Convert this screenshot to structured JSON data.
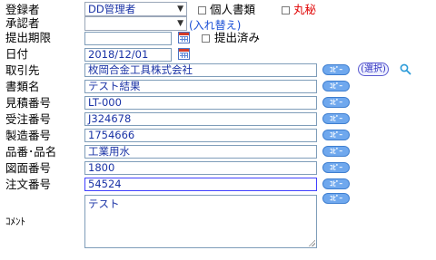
{
  "labels": {
    "registrant": "登録者",
    "approver": "承認者",
    "due_date": "提出期限",
    "date": "日付",
    "client": "取引先",
    "doc_name": "書類名",
    "estimate_no": "見積番号",
    "order_no": "受注番号",
    "mfg_no": "製造番号",
    "product": "品番･品名",
    "drawing_no": "図面番号",
    "purchase_no": "注文番号",
    "comment": "ｺﾒﾝﾄ"
  },
  "registrant": {
    "value": "DD管理者"
  },
  "approver": {
    "value": "",
    "swap_link": "(入れ替え)"
  },
  "checkboxes": {
    "personal": "個人書類",
    "confidential": "丸秘",
    "submitted": "提出済み"
  },
  "fields": {
    "due_date": "",
    "date": "2018/12/01",
    "client": "枚岡合金工具株式会社",
    "doc_name": "テスト結果",
    "estimate_no": "LT-000",
    "order_no": "J324678",
    "mfg_no": "1754666",
    "product": "工業用水",
    "drawing_no": "1800",
    "purchase_no": "54524",
    "comment": "テスト"
  },
  "buttons": {
    "copy": "ｺﾋﾟｰ",
    "select": "選択"
  },
  "colors": {
    "field_text": "#1a33a6",
    "confidential": "#e00000",
    "copy_button": "#6fa8ee",
    "link": "#1a4fd6"
  }
}
